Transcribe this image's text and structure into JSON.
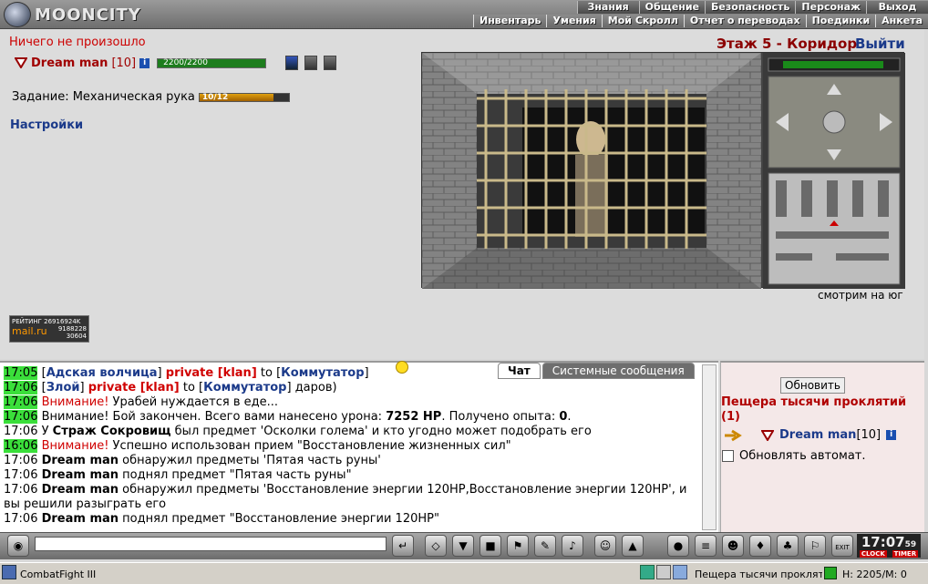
{
  "app": {
    "logo_text": "MOONCITY"
  },
  "nav": {
    "top": [
      "Знания",
      "Общение",
      "Безопасность",
      "Персонаж",
      "Выход"
    ],
    "bottom": [
      "Инвентарь",
      "Умения",
      "Мой Скролл",
      "Отчет о переводах",
      "Поединки",
      "Анкета"
    ]
  },
  "status_text": "Ничего не произошло",
  "player": {
    "name": "Dream man",
    "level": "[10]",
    "hp": "2200/2200",
    "hp_fraction": 1.0
  },
  "quest": {
    "label": "Задание: Механическая рука",
    "progress": "10/12",
    "progress_fraction": 0.83
  },
  "settings_label": "Настройки",
  "location": {
    "floor": "Этаж 5 - Коридор",
    "exit_label": "Выйти",
    "facing": "смотрим на юг"
  },
  "rating": {
    "label": "РЕЙТИНГ 26916924K",
    "site": "mail.ru",
    "n1": "9188228",
    "n2": "30604"
  },
  "chat": {
    "tabs": [
      "Чат",
      "Системные сообщения"
    ],
    "lines": [
      {
        "time": "17:05",
        "hl": true,
        "parts": [
          [
            "t",
            "["
          ],
          [
            "blue",
            "Адская волчица"
          ],
          [
            "t",
            "] "
          ],
          [
            "priv",
            "private [klan]"
          ],
          [
            "t",
            " to ["
          ],
          [
            "blue",
            "Коммутатор"
          ],
          [
            "t",
            "]"
          ]
        ]
      },
      {
        "time": "17:06",
        "hl": true,
        "parts": [
          [
            "t",
            "["
          ],
          [
            "blue",
            "Злой"
          ],
          [
            "t",
            "] "
          ],
          [
            "priv",
            "private [klan]"
          ],
          [
            "t",
            " to ["
          ],
          [
            "blue",
            "Коммутатор"
          ],
          [
            "t",
            "] даров)"
          ]
        ]
      },
      {
        "time": "17:06",
        "hl": true,
        "parts": [
          [
            "red",
            "Внимание!"
          ],
          [
            "t",
            " Урабей нуждается в еде..."
          ]
        ]
      },
      {
        "time": "17:06",
        "hl": true,
        "parts": [
          [
            "t",
            "Внимание! Бой закончен. Всего вами нанесено урона: "
          ],
          [
            "b",
            "7252 HP"
          ],
          [
            "t",
            ". Получено опыта: "
          ],
          [
            "b",
            "0"
          ],
          [
            "t",
            "."
          ]
        ]
      },
      {
        "time": "17:06",
        "hl": false,
        "parts": [
          [
            "t",
            "У "
          ],
          [
            "b",
            "Страж Сокровищ"
          ],
          [
            "t",
            " был предмет 'Осколки голема' и кто угодно может подобрать его"
          ]
        ]
      },
      {
        "time": "16:06",
        "hl": true,
        "parts": [
          [
            "red",
            "Внимание!"
          ],
          [
            "t",
            " Успешно использован прием \"Восстановление жизненных сил\""
          ]
        ]
      },
      {
        "time": "17:06",
        "hl": false,
        "parts": [
          [
            "b",
            "Dream man"
          ],
          [
            "t",
            " обнаружил предметы 'Пятая часть руны'"
          ]
        ]
      },
      {
        "time": "17:06",
        "hl": false,
        "parts": [
          [
            "b",
            "Dream man"
          ],
          [
            "t",
            " поднял предмет \"Пятая часть руны\""
          ]
        ]
      },
      {
        "time": "17:06",
        "hl": false,
        "wrap": true,
        "parts": [
          [
            "b",
            "Dream man"
          ],
          [
            "t",
            " обнаружил предметы 'Восстановление энергии 120HP,Восстановление энергии 120HP', и вы решили разыграть его"
          ]
        ]
      },
      {
        "time": "17:06",
        "hl": false,
        "parts": [
          [
            "b",
            "Dream man"
          ],
          [
            "t",
            " поднял предмет \"Восстановление энергии 120HP\""
          ]
        ]
      }
    ]
  },
  "right_panel": {
    "refresh_label": "Обновить",
    "location_title": "Пещера тысячи проклятий (1)",
    "player_name": "Dream man",
    "player_level": "[10]",
    "auto_label": "Обновлять автомат."
  },
  "clock": {
    "time": "17:07",
    "seconds": "59",
    "btn_clock": "CLOCK",
    "btn_timer": "TIMER",
    "exit": "EXIT"
  },
  "taskbar": {
    "app": "CombatFight III",
    "window": "Пещера тысячи проклятий",
    "hp": "H: 2205/M: 0"
  },
  "colors": {
    "accent_red": "#a00000",
    "link_blue": "#1b3a8a",
    "hp_green": "#1d7d1d",
    "time_hl": "#3adf3a"
  }
}
